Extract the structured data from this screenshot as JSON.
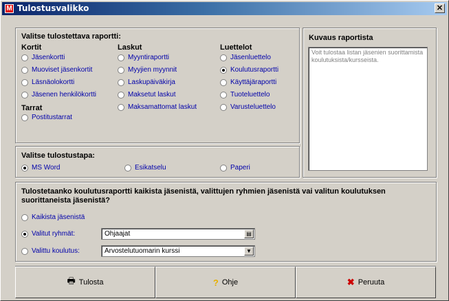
{
  "window": {
    "title": "Tulostusvalikko",
    "app_icon": "M",
    "close_icon": "close-icon"
  },
  "report_group": {
    "label": "Valitse tulostettava raportti:",
    "columns": [
      {
        "heading": "Kortit",
        "items": [
          "Jäsenkortti",
          "Muoviset jäsenkortit",
          "Läsnäolokortti",
          "Jäsenen henkilökortti"
        ]
      },
      {
        "heading": "Laskut",
        "items": [
          "Myyntiraportti",
          "Myyjien myynnit",
          "Laskupäiväkirja",
          "Maksetut laskut",
          "Maksamattomat laskut"
        ]
      },
      {
        "heading": "Luettelot",
        "items": [
          "Jäsenluettelo",
          "Koulutusraportti",
          "Käyttäjäraportti",
          "Tuoteluettelo",
          "Varusteluettelo"
        ]
      }
    ],
    "tarrat_heading": "Tarrat",
    "tarrat_items": [
      "Postitustarrat"
    ],
    "selected": "Koulutusraportti"
  },
  "description": {
    "label": "Kuvaus raportista",
    "text": "Voit tulostaa listan jäsenien suorittamista koulutuksista/kursseista."
  },
  "method_group": {
    "label": "Valitse tulostustapa:",
    "options": [
      "MS Word",
      "Esikatselu",
      "Paperi"
    ],
    "selected": "MS Word"
  },
  "scope": {
    "question": "Tulostetaanko koulutusraportti kaikista jäsenistä, valittujen ryhmien jäsenistä vai valitun koulutuksen suorittaneista jäsenistä?",
    "all_label": "Kaikista jäsenistä",
    "groups_label": "Valitut ryhmät:",
    "groups_value": "Ohjaajat",
    "training_label": "Valittu koulutus:",
    "training_value": "Arvostelutuomarin kurssi",
    "selected": "groups"
  },
  "buttons": {
    "print": "Tulosta",
    "help": "Ohje",
    "cancel": "Peruuta",
    "print_icon": "printer-icon",
    "help_icon": "question-icon",
    "cancel_icon": "x-icon",
    "cancel_color": "#cc0000",
    "help_color": "#e8b000"
  }
}
